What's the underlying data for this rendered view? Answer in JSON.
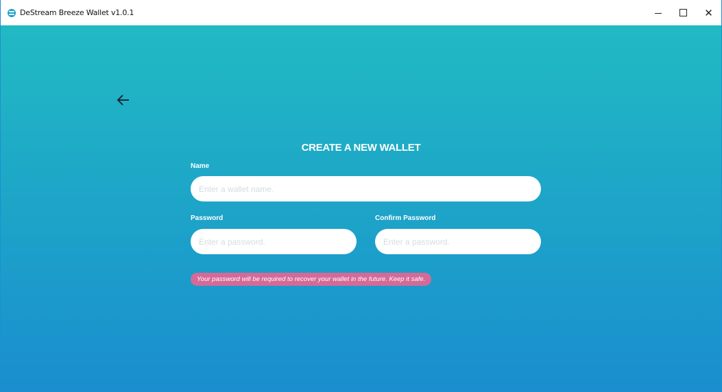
{
  "window": {
    "title": "DeStream Breeze Wallet v1.0.1",
    "controls": {
      "minimize": "minimize-icon",
      "maximize": "maximize-icon",
      "close": "close-icon"
    }
  },
  "page": {
    "back_icon": "arrow-left-icon",
    "heading": "CREATE A NEW WALLET",
    "name_label": "Name",
    "name_placeholder": "Enter a wallet name.",
    "name_value": "",
    "password_label": "Password",
    "password_placeholder": "Enter a password.",
    "password_value": "",
    "confirm_label": "Confirm Password",
    "confirm_placeholder": "Enter a password.",
    "confirm_value": "",
    "warning": "Your password will be required to recover your wallet in the future. Keep it safe."
  },
  "colors": {
    "gradient_top": "#21bac3",
    "gradient_bottom": "#1a8ecf",
    "warning_bg": "#d56a98",
    "window_border": "#1d8fd2"
  }
}
